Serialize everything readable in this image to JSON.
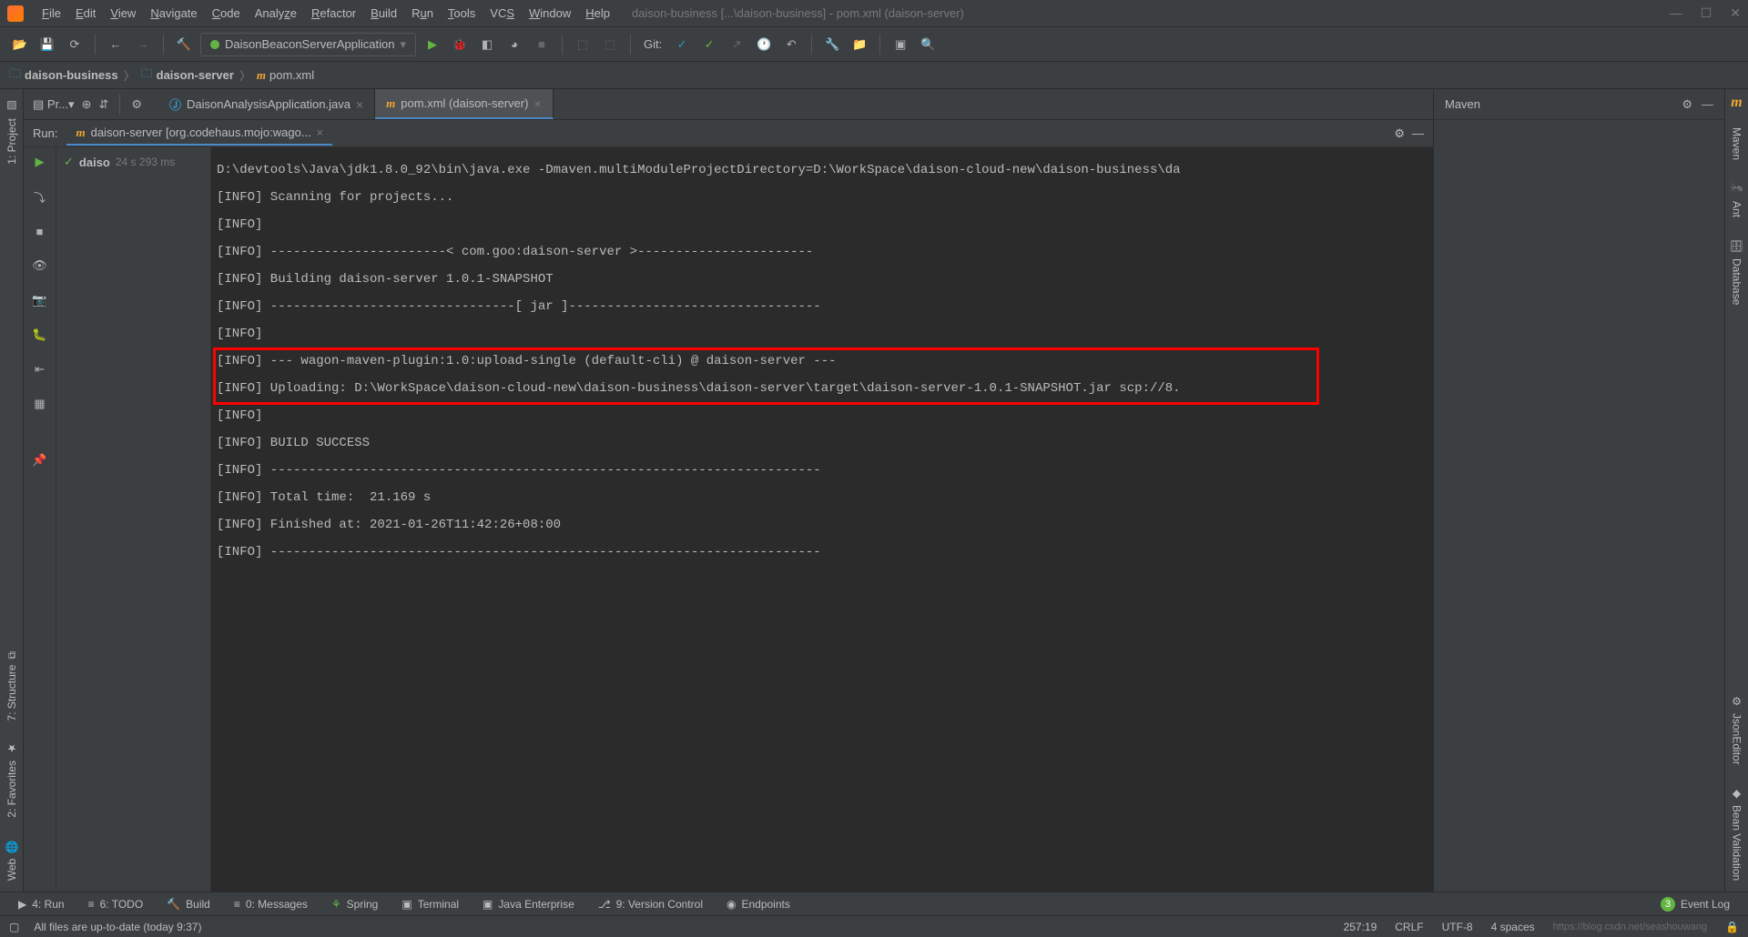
{
  "menus": [
    "File",
    "Edit",
    "View",
    "Navigate",
    "Code",
    "Analyze",
    "Refactor",
    "Build",
    "Run",
    "Tools",
    "VCS",
    "Window",
    "Help"
  ],
  "title": "daison-business [...\\daison-business] - pom.xml (daison-server)",
  "runConfig": "DaisonBeaconServerApplication",
  "git": "Git:",
  "breadcrumb": {
    "root": "daison-business",
    "module": "daison-server",
    "file": "pom.xml"
  },
  "projectSelector": "Pr...",
  "editorTabs": [
    {
      "label": "DaisonAnalysisApplication.java",
      "icon": "j",
      "active": false
    },
    {
      "label": "pom.xml (daison-server)",
      "icon": "m",
      "active": true
    }
  ],
  "maven": {
    "title": "Maven"
  },
  "run": {
    "label": "Run:",
    "tab": "daison-server [org.codehaus.mojo:wago...",
    "tree": {
      "name": "daiso",
      "time": "24 s 293 ms"
    }
  },
  "console_lines": [
    "D:\\devtools\\Java\\jdk1.8.0_92\\bin\\java.exe -Dmaven.multiModuleProjectDirectory=D:\\WorkSpace\\daison-cloud-new\\daison-business\\da",
    "[INFO] Scanning for projects...",
    "[INFO]",
    "[INFO] -----------------------< com.goo:daison-server >-----------------------",
    "[INFO] Building daison-server 1.0.1-SNAPSHOT",
    "[INFO] --------------------------------[ jar ]---------------------------------",
    "[INFO]",
    "[INFO] --- wagon-maven-plugin:1.0:upload-single (default-cli) @ daison-server ---",
    "[INFO] Uploading: D:\\WorkSpace\\daison-cloud-new\\daison-business\\daison-server\\target\\daison-server-1.0.1-SNAPSHOT.jar scp://8.",
    "[INFO]",
    "[INFO] BUILD SUCCESS",
    "[INFO] ------------------------------------------------------------------------",
    "[INFO] Total time:  21.169 s",
    "[INFO] Finished at: 2021-01-26T11:42:26+08:00",
    "[INFO] ------------------------------------------------------------------------"
  ],
  "leftRail": [
    "1: Project",
    "7: Structure",
    "2: Favorites",
    "Web"
  ],
  "rightRail": [
    "Maven",
    "Ant",
    "Database",
    "JsonEditor",
    "Bean Validation"
  ],
  "bottomTabs": [
    {
      "icon": "▶",
      "label": "4: Run"
    },
    {
      "icon": "≡",
      "label": "6: TODO"
    },
    {
      "icon": "🔨",
      "label": "Build"
    },
    {
      "icon": "≡",
      "label": "0: Messages"
    },
    {
      "icon": "⚘",
      "label": "Spring"
    },
    {
      "icon": "▣",
      "label": "Terminal"
    },
    {
      "icon": "▣",
      "label": "Java Enterprise"
    },
    {
      "icon": "⎇",
      "label": "9: Version Control"
    },
    {
      "icon": "◉",
      "label": "Endpoints"
    }
  ],
  "eventLog": {
    "badge": "3",
    "label": "Event Log"
  },
  "status": {
    "msg": "All files are up-to-date (today 9:37)",
    "pos": "257:19",
    "eol": "CRLF",
    "enc": "UTF-8",
    "indent": "4 spaces",
    "watermark": "https://blog.csdn.net/seashouwang"
  }
}
